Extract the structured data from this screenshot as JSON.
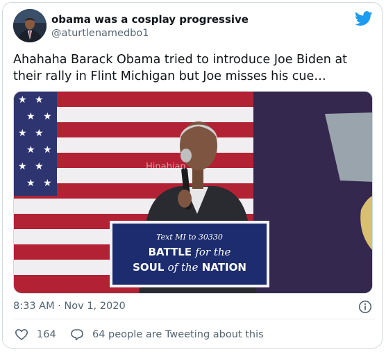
{
  "user": {
    "display_name": "obama was a cosplay progressive",
    "handle": "@aturtlenamedbo1"
  },
  "tweet": {
    "text": "Ahahaha Barack Obama tried to introduce Joe Biden at their rally in Flint Michigan but Joe misses his cue…",
    "timestamp": "8:33 AM · Nov 1, 2020"
  },
  "media": {
    "sign_line1": "Text MI to 30330",
    "sign_line2a": "BATTLE",
    "sign_line2b": "for the",
    "sign_line3a": "SOUL",
    "sign_line3b": "of the",
    "sign_line3c": "NATION",
    "watermark": "Hinabian"
  },
  "footer": {
    "likes": "164",
    "replies_text": "64 people are Tweeting about this"
  },
  "colors": {
    "twitter_blue": "#1d9bf0",
    "text_primary": "#0f1419",
    "text_secondary": "#536471",
    "sign_blue": "#1c2c6e"
  },
  "icons": {
    "brand": "twitter-bird-icon",
    "info": "info-icon",
    "like": "heart-icon",
    "reply": "comment-bubble-icon"
  }
}
